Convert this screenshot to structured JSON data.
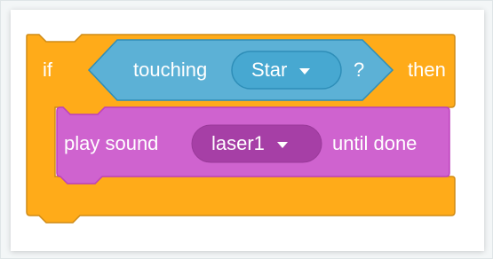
{
  "block": {
    "if_label": "if",
    "then_label": "then",
    "condition": {
      "label": "touching",
      "dropdown_value": "Star",
      "question_label": "?"
    },
    "action": {
      "label_play": "play sound",
      "dropdown_value": "laser1",
      "label_until": "until done"
    }
  },
  "colors": {
    "control": "#ffab19",
    "control_border": "#cf8b17",
    "sensing": "#5cb1d6",
    "sensing_border": "#2e8eb8",
    "sensing_field": "#47a8d1",
    "sound": "#cf63cf",
    "sound_border": "#bd42bd",
    "sound_field": "#a63fa6"
  },
  "icons": {
    "dropdown": "caret-down-icon"
  }
}
